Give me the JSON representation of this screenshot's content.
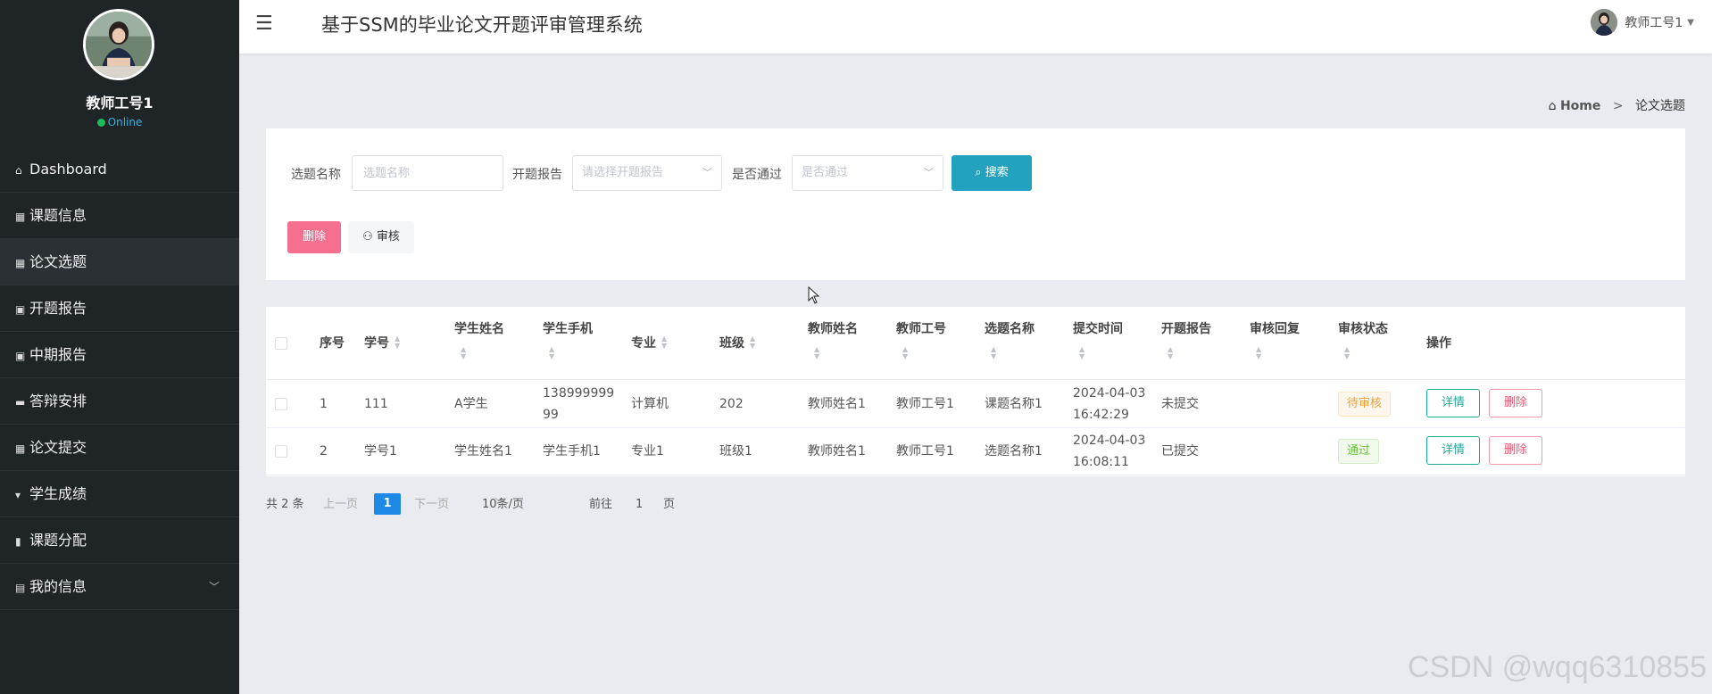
{
  "sidebar": {
    "user_name": "教师工号1",
    "status": "Online",
    "items": [
      {
        "label": "Dashboard",
        "icon": "house-icon",
        "glyph": "⌂"
      },
      {
        "label": "课题信息",
        "icon": "grid-icon",
        "glyph": "▦"
      },
      {
        "label": "论文选题",
        "icon": "grid-icon",
        "glyph": "▦",
        "active": true
      },
      {
        "label": "开题报告",
        "icon": "clipboard-icon",
        "glyph": "▣"
      },
      {
        "label": "中期报告",
        "icon": "clipboard-icon",
        "glyph": "▣"
      },
      {
        "label": "答辩安排",
        "icon": "ticket-icon",
        "glyph": "▬"
      },
      {
        "label": "论文提交",
        "icon": "grid-icon",
        "glyph": "▦"
      },
      {
        "label": "学生成绩",
        "icon": "trophy-icon",
        "glyph": "▾"
      },
      {
        "label": "课题分配",
        "icon": "bar-chart-icon",
        "glyph": "▮"
      },
      {
        "label": "我的信息",
        "icon": "id-card-icon",
        "glyph": "▤",
        "has_children": true
      }
    ]
  },
  "header": {
    "title": "基于SSM的毕业论文开题评审管理系统",
    "user_label": "教师工号1"
  },
  "breadcrumb": {
    "home": "Home",
    "current": "论文选题"
  },
  "search": {
    "topic_label": "选题名称",
    "topic_placeholder": "选题名称",
    "report_label": "开题报告",
    "report_placeholder": "请选择开题报告",
    "pass_label": "是否通过",
    "pass_placeholder": "是否通过",
    "search_button": "搜索",
    "delete_button": "删除",
    "audit_button": "审核"
  },
  "table": {
    "headers": {
      "index": "序号",
      "student_no": "学号",
      "student_name": "学生姓名",
      "student_phone": "学生手机",
      "major": "专业",
      "class": "班级",
      "teacher_name": "教师姓名",
      "teacher_no": "教师工号",
      "topic_name": "选题名称",
      "submit_time": "提交时间",
      "report": "开题报告",
      "reply": "审核回复",
      "status": "审核状态",
      "actions": "操作"
    },
    "rows": [
      {
        "index": "1",
        "student_no": "111",
        "student_name": "A学生",
        "student_phone_line1": "138999999",
        "student_phone_line2": "99",
        "major": "计算机",
        "class": "202",
        "teacher_name": "教师姓名1",
        "teacher_no": "教师工号1",
        "topic_name": "课题名称1",
        "submit_date": "2024-04-03",
        "submit_clock": "16:42:29",
        "report": "未提交",
        "reply": "",
        "status": "待审核",
        "detail_button": "详情",
        "delete_button": "删除"
      },
      {
        "index": "2",
        "student_no": "学号1",
        "student_name": "学生姓名1",
        "student_phone": "学生手机1",
        "major": "专业1",
        "class": "班级1",
        "teacher_name": "教师姓名1",
        "teacher_no": "教师工号1",
        "topic_name": "选题名称1",
        "submit_date": "2024-04-03",
        "submit_clock": "16:08:11",
        "report": "已提交",
        "reply": "",
        "status": "通过",
        "detail_button": "详情",
        "delete_button": "删除"
      }
    ]
  },
  "pagination": {
    "total": "共 2 条",
    "prev": "上一页",
    "current_page": "1",
    "next": "下一页",
    "page_size": "10条/页",
    "goto_label": "前往",
    "goto_value": "1",
    "page_suffix": "页"
  },
  "watermark": "CSDN @wqq6310855",
  "colors": {
    "sidebar_bg": "#1f2426",
    "search_button": "#22a2be",
    "delete_button": "#f56f8f",
    "detail_border": "#1ea896",
    "pending": "#e6a23c",
    "pass": "#67c23a",
    "page_active": "#1e88e5"
  }
}
